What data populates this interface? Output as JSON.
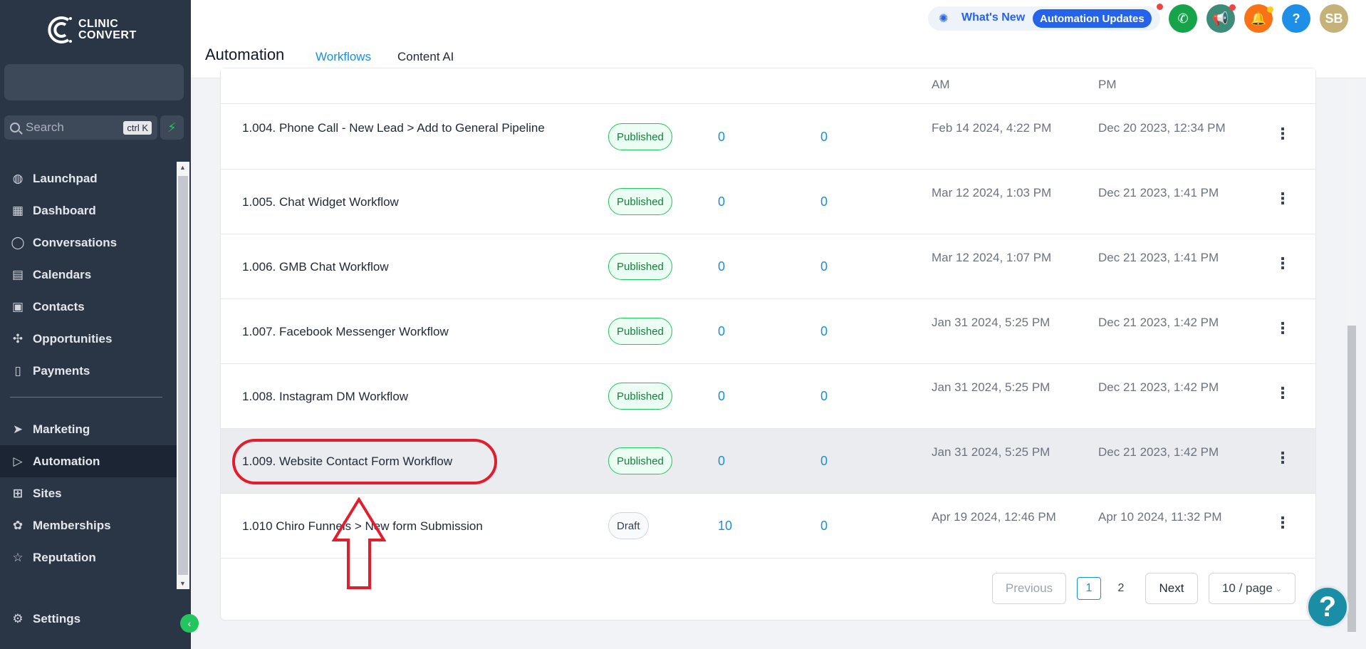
{
  "brand": {
    "line1": "CLINIC",
    "line2": "CONVERT"
  },
  "search": {
    "placeholder": "Search",
    "shortcut": "ctrl K"
  },
  "sidebar": {
    "items": [
      {
        "label": "Launchpad",
        "icon": "launchpad-icon"
      },
      {
        "label": "Dashboard",
        "icon": "dashboard-icon"
      },
      {
        "label": "Conversations",
        "icon": "chat-icon"
      },
      {
        "label": "Calendars",
        "icon": "calendar-icon"
      },
      {
        "label": "Contacts",
        "icon": "contacts-icon"
      },
      {
        "label": "Opportunities",
        "icon": "opportunities-icon"
      },
      {
        "label": "Payments",
        "icon": "payments-icon"
      }
    ],
    "items2": [
      {
        "label": "Marketing",
        "icon": "send-icon"
      },
      {
        "label": "Automation",
        "icon": "automation-icon"
      },
      {
        "label": "Sites",
        "icon": "sites-icon"
      },
      {
        "label": "Memberships",
        "icon": "memberships-icon"
      },
      {
        "label": "Reputation",
        "icon": "star-icon"
      }
    ],
    "settings": "Settings"
  },
  "header": {
    "title": "Automation",
    "tabs": [
      "Workflows",
      "Content AI"
    ],
    "whats_new": "What's New",
    "automation_updates": "Automation Updates",
    "avatar": "SB",
    "help": "?"
  },
  "partial_row": {
    "date1": "AM",
    "date2": "PM"
  },
  "rows": [
    {
      "name": "1.004. Phone Call - New Lead > Add to General Pipeline",
      "status": "Published",
      "a": "0",
      "b": "0",
      "d1": "Feb 14 2024, 4:22 PM",
      "d2": "Dec 20 2023, 12:34 PM"
    },
    {
      "name": "1.005. Chat Widget Workflow",
      "status": "Published",
      "a": "0",
      "b": "0",
      "d1": "Mar 12 2024, 1:03 PM",
      "d2": "Dec 21 2023, 1:41 PM"
    },
    {
      "name": "1.006. GMB Chat Workflow",
      "status": "Published",
      "a": "0",
      "b": "0",
      "d1": "Mar 12 2024, 1:07 PM",
      "d2": "Dec 21 2023, 1:41 PM"
    },
    {
      "name": "1.007. Facebook Messenger Workflow",
      "status": "Published",
      "a": "0",
      "b": "0",
      "d1": "Jan 31 2024, 5:25 PM",
      "d2": "Dec 21 2023, 1:42 PM"
    },
    {
      "name": "1.008. Instagram DM Workflow",
      "status": "Published",
      "a": "0",
      "b": "0",
      "d1": "Jan 31 2024, 5:25 PM",
      "d2": "Dec 21 2023, 1:42 PM"
    },
    {
      "name": "1.009. Website Contact Form Workflow",
      "status": "Published",
      "a": "0",
      "b": "0",
      "d1": "Jan 31 2024, 5:25 PM",
      "d2": "Dec 21 2023, 1:42 PM"
    },
    {
      "name": "1.010 Chiro Funnels > New form Submission",
      "status": "Draft",
      "a": "10",
      "b": "0",
      "d1": "Apr 19 2024, 12:46 PM",
      "d2": "Apr 10 2024, 11:32 PM"
    }
  ],
  "pagination": {
    "previous": "Previous",
    "pages": [
      "1",
      "2"
    ],
    "next": "Next",
    "per_page": "10 / page"
  },
  "colors": {
    "sidebar": "#2a3546",
    "accent": "#1d8fd6",
    "published": "#22c55e",
    "annotation": "#e11d2e"
  }
}
